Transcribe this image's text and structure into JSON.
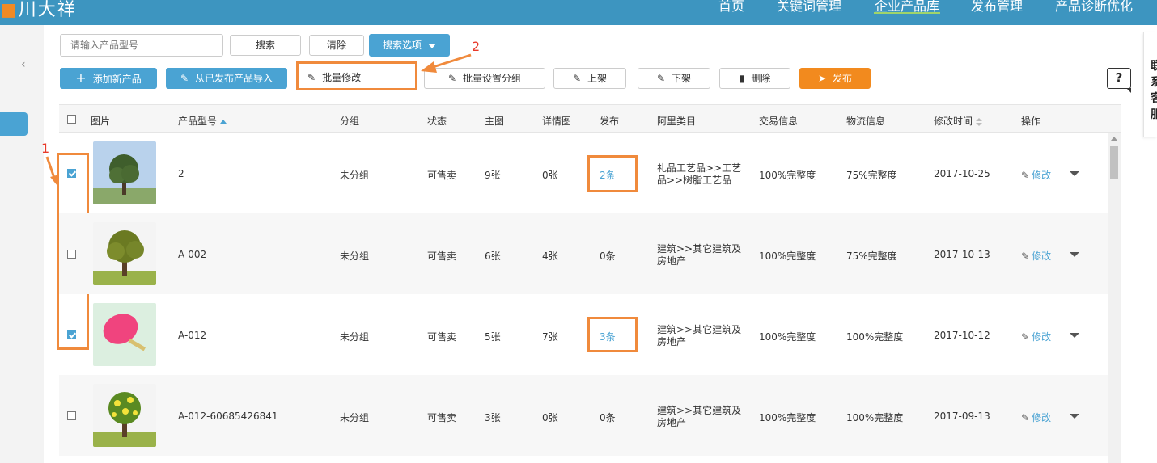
{
  "header": {
    "logo_text": "川大祥",
    "nav": [
      "首页",
      "关键词管理",
      "企业产品库",
      "发布管理",
      "产品诊断优化"
    ],
    "active_nav": "企业产品库"
  },
  "right_panel": {
    "label": "联系客服"
  },
  "search": {
    "placeholder": "请输入产品型号",
    "search_label": "搜索",
    "clear_label": "清除",
    "options_label": "搜索选项"
  },
  "toolbar": {
    "add": "添加新产品",
    "import": "从已发布产品导入",
    "batch_edit": "批量修改",
    "batch_group": "批量设置分组",
    "shelf_on": "上架",
    "shelf_off": "下架",
    "delete": "删除",
    "publish": "发布",
    "help": "?"
  },
  "annotations": {
    "one": "1",
    "two": "2"
  },
  "table": {
    "headers": [
      "图片",
      "产品型号",
      "分组",
      "状态",
      "主图",
      "详情图",
      "发布",
      "阿里类目",
      "交易信息",
      "物流信息",
      "修改时间",
      "操作"
    ],
    "edit_label": "修改",
    "rows": [
      {
        "checked": true,
        "model": "2",
        "group": "未分组",
        "status": "可售卖",
        "main": "9张",
        "detail": "0张",
        "publish": "2条",
        "publish_link": true,
        "category": "礼品工艺品>>工艺品>>树脂工艺品",
        "trade": "100%完整度",
        "logistics": "75%完整度",
        "modified": "2017-10-25"
      },
      {
        "checked": false,
        "model": "A-002",
        "group": "未分组",
        "status": "可售卖",
        "main": "6张",
        "detail": "4张",
        "publish": "0条",
        "publish_link": false,
        "category": "建筑>>其它建筑及房地产",
        "trade": "100%完整度",
        "logistics": "75%完整度",
        "modified": "2017-10-13"
      },
      {
        "checked": true,
        "model": "A-012",
        "group": "未分组",
        "status": "可售卖",
        "main": "5张",
        "detail": "7张",
        "publish": "3条",
        "publish_link": true,
        "category": "建筑>>其它建筑及房地产",
        "trade": "100%完整度",
        "logistics": "100%完整度",
        "modified": "2017-10-12"
      },
      {
        "checked": false,
        "model": "A-012-60685426841",
        "group": "未分组",
        "status": "可售卖",
        "main": "3张",
        "detail": "0张",
        "publish": "0条",
        "publish_link": false,
        "category": "建筑>>其它建筑及房地产",
        "trade": "100%完整度",
        "logistics": "100%完整度",
        "modified": "2017-09-13"
      }
    ]
  },
  "colors": {
    "primary": "#3d95c0",
    "accent_blue": "#4aa3d3",
    "accent_orange": "#f28a1e",
    "annotation": "#f08a3c"
  }
}
